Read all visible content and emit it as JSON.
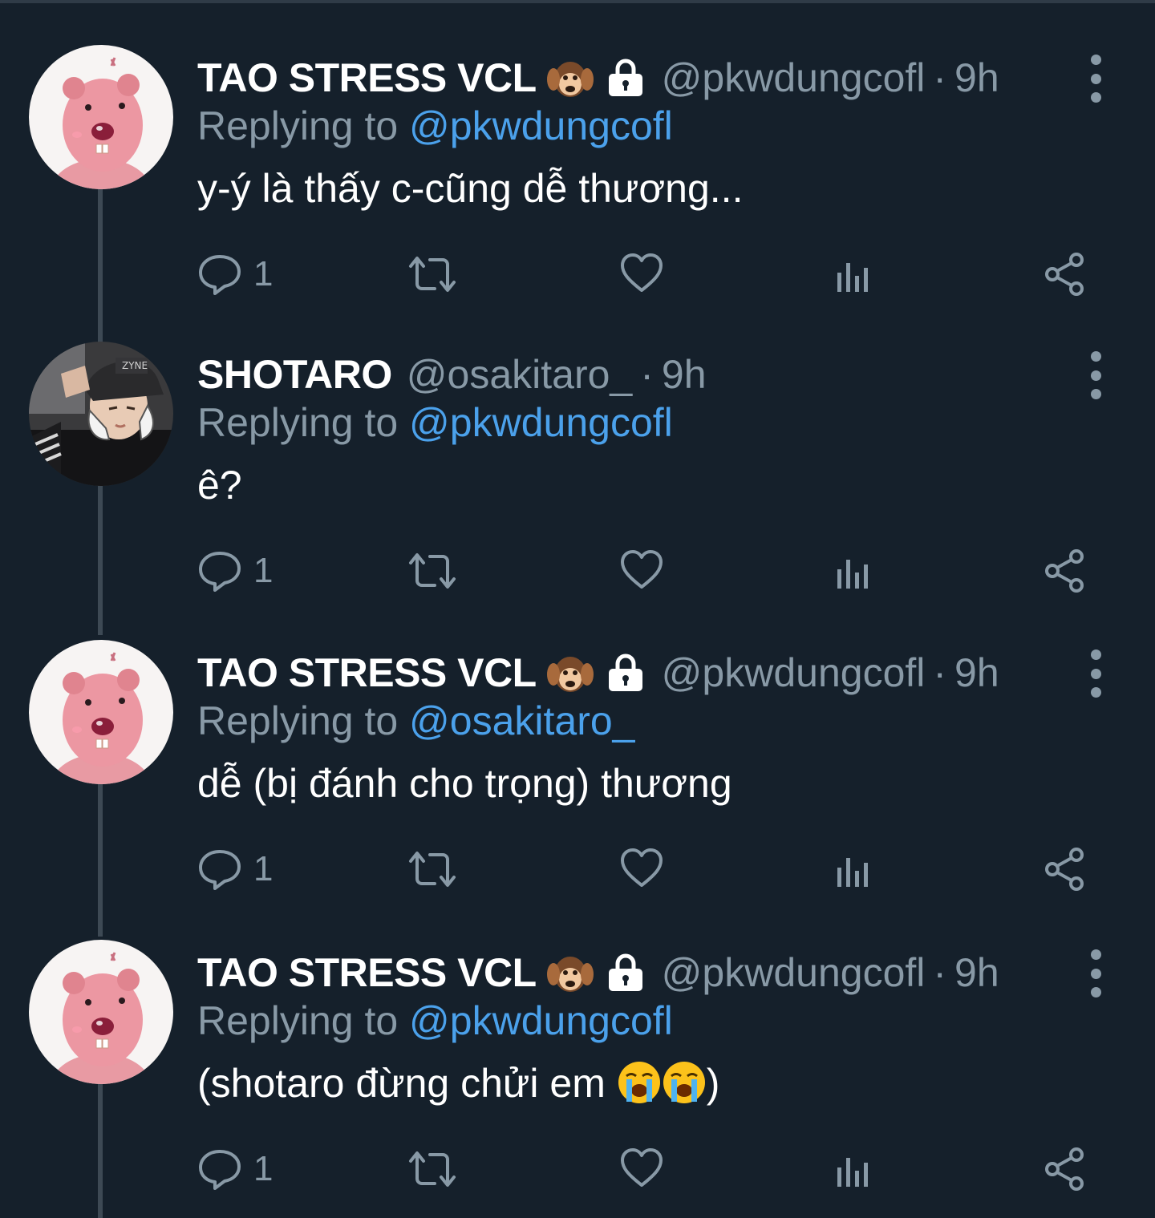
{
  "tweets": [
    {
      "avatar": "pink-beaver-avatar",
      "display_name": "TAO STRESS VCL",
      "badge_emoji": "hear-no-evil-monkey",
      "locked": true,
      "handle": "@pkwdungcofl",
      "dot": "·",
      "time": "9h",
      "reply_prefix": "Replying to ",
      "reply_to": "@pkwdungcofl",
      "text": "y-ý là thấy c-cũng dễ thương...",
      "reply_count": "1"
    },
    {
      "avatar": "person-bandana-avatar",
      "display_name": "SHOTARO",
      "badge_emoji": "",
      "locked": false,
      "handle": "@osakitaro_",
      "dot": "·",
      "time": "9h",
      "reply_prefix": "Replying to ",
      "reply_to": "@pkwdungcofl",
      "text": "ê?",
      "reply_count": "1"
    },
    {
      "avatar": "pink-beaver-avatar",
      "display_name": "TAO STRESS VCL",
      "badge_emoji": "hear-no-evil-monkey",
      "locked": true,
      "handle": "@pkwdungcofl",
      "dot": "·",
      "time": "9h",
      "reply_prefix": "Replying to ",
      "reply_to": "@osakitaro_",
      "text": "dễ (bị đánh cho trọng) thương",
      "reply_count": "1"
    },
    {
      "avatar": "pink-beaver-avatar",
      "display_name": "TAO STRESS VCL",
      "badge_emoji": "hear-no-evil-monkey",
      "locked": true,
      "handle": "@pkwdungcofl",
      "dot": "·",
      "time": "9h",
      "reply_prefix": "Replying to ",
      "reply_to": "@pkwdungcofl",
      "text": "(shotaro đừng chửi em ",
      "text_emojis": [
        "loudly-crying-face",
        "loudly-crying-face"
      ],
      "text_suffix": ")",
      "reply_count": "1"
    }
  ],
  "colors": {
    "background": "#15202b",
    "primary_text": "#ffffff",
    "secondary_text": "#8899a6",
    "link": "#4ba1eb",
    "thread_line": "#3d4954"
  }
}
